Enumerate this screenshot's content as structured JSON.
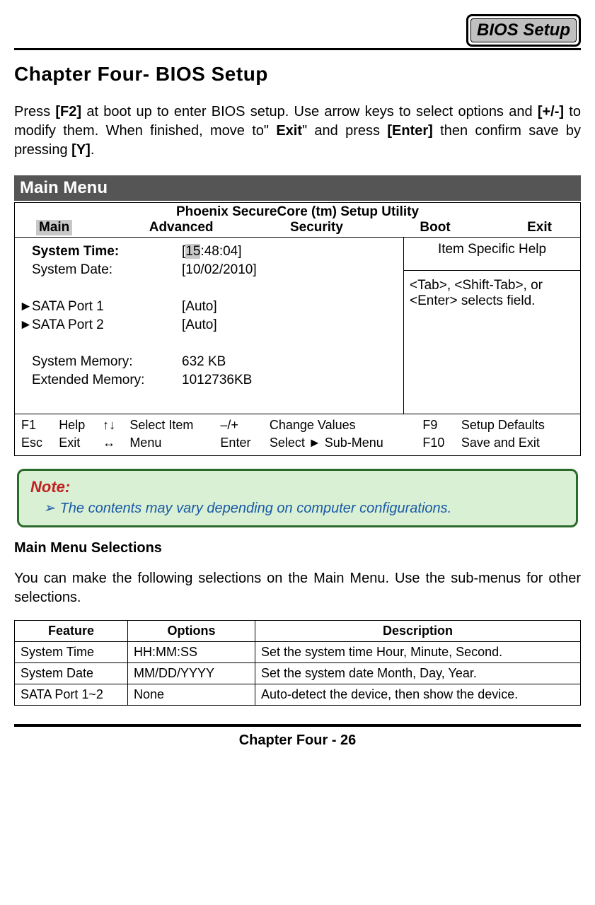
{
  "header": {
    "badge": "BIOS Setup"
  },
  "chapter_title": "Chapter Four- BIOS Setup",
  "intro": {
    "p1a": "Press ",
    "f2": "[F2]",
    "p1b": " at boot up to enter BIOS setup. Use arrow keys to select options and ",
    "pm": "[+/-]",
    "p1c": " to modify them. When finished, move to\" ",
    "exit": "Exit",
    "p1d": "\" and press ",
    "enter": "[Enter]",
    "p1e": " then confirm save by pressing ",
    "y": "[Y]",
    "p1f": "."
  },
  "section_bar": "Main Menu",
  "bios": {
    "title": "Phoenix SecureCore (tm) Setup Utility",
    "tabs": [
      "Main",
      "Advanced",
      "Security",
      "Boot",
      "Exit"
    ],
    "rows": {
      "time_label": "System Time:",
      "time_hl": "15",
      "time_rest": ":48:04]",
      "time_br": "[",
      "date_label": "System Date:",
      "date_value": "[10/02/2010]",
      "sata1_label": "SATA Port 1",
      "sata1_value": "[Auto]",
      "sata2_label": "SATA Port 2",
      "sata2_value": "[Auto]",
      "mem_label": "System Memory:",
      "mem_value": "632 KB",
      "ext_label": "Extended Memory:",
      "ext_value": "1012736KB"
    },
    "help_title": "Item Specific Help",
    "help_body": "<Tab>, <Shift-Tab>, or <Enter> selects field.",
    "footer": {
      "c1a": "F1",
      "c1b": "Help",
      "c2a": "↑↓",
      "c2b": "Select Item",
      "c3a": "–/+",
      "c3b": "Change Values",
      "c4a": "F9",
      "c4b": "Setup Defaults",
      "d1a": "Esc",
      "d1b": "Exit",
      "d2a": "↔",
      "d2b": "Menu",
      "d3a": "Enter",
      "d3b": "Select ► Sub-Menu",
      "d4a": "F10",
      "d4b": "Save and Exit"
    }
  },
  "note": {
    "title": "Note:",
    "body": "The contents may vary depending on computer configurations."
  },
  "subhead": "Main Menu Selections",
  "para": "You can make the following selections on the Main Menu. Use the sub-menus for other selections.",
  "table": {
    "h1": "Feature",
    "h2": "Options",
    "h3": "Description",
    "rows": [
      {
        "f": "System Time",
        "o": "HH:MM:SS",
        "d": "Set the system time Hour, Minute, Second."
      },
      {
        "f": "System Date",
        "o": "MM/DD/YYYY",
        "d": "Set the system date Month, Day, Year."
      },
      {
        "f": "SATA Port 1~2",
        "o": "None",
        "d": "Auto-detect the device, then show the device."
      }
    ]
  },
  "footer": "Chapter Four - 26"
}
